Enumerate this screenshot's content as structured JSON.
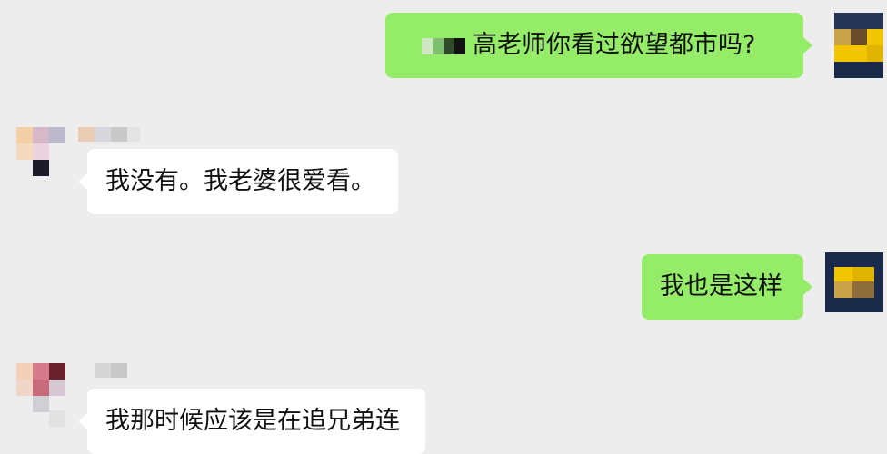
{
  "messages": [
    {
      "side": "out",
      "text": "高老师你看过欲望都市吗?"
    },
    {
      "side": "in",
      "text": "我没有。我老婆很爱看。"
    },
    {
      "side": "out",
      "text": "我也是这样"
    },
    {
      "side": "in",
      "text": "我那时候应该是在追兄弟连"
    }
  ],
  "colors": {
    "background": "#ededed",
    "outgoing_bubble": "#95ec69",
    "incoming_bubble": "#ffffff",
    "avatar_navy": "#1a2a4a",
    "avatar_yellow": "#f2c500"
  }
}
